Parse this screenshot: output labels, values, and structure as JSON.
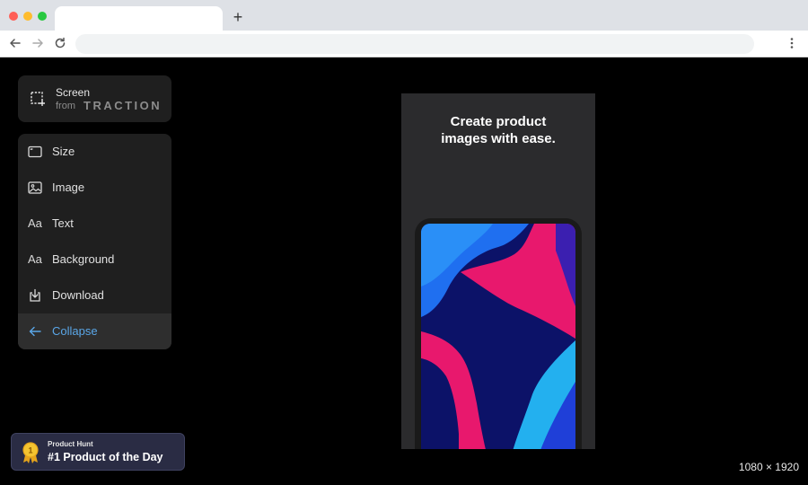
{
  "browser": {
    "new_tab_label": "+",
    "nav_back_icon": "arrow-left-icon",
    "nav_forward_icon": "arrow-right-icon",
    "reload_icon": "reload-icon",
    "menu_icon": "kebab-menu-icon"
  },
  "brand": {
    "title": "Screen",
    "from": "from",
    "company": "TRACTION",
    "icon": "screen-select-icon"
  },
  "menu": {
    "items": [
      {
        "label": "Size",
        "icon": "size-frame-icon"
      },
      {
        "label": "Image",
        "icon": "image-icon"
      },
      {
        "label": "Text",
        "icon": "text-aa-icon"
      },
      {
        "label": "Background",
        "icon": "text-aa-icon"
      },
      {
        "label": "Download",
        "icon": "download-icon"
      },
      {
        "label": "Collapse",
        "icon": "arrow-left-icon"
      }
    ]
  },
  "preview": {
    "headline_line1": "Create product",
    "headline_line2": "images with ease."
  },
  "product_hunt": {
    "small": "Product Hunt",
    "big": "#1 Product of the Day",
    "medal_number": "1"
  },
  "canvas": {
    "dimensions": "1080 × 1920"
  },
  "colors": {
    "accent": "#5aa7e8",
    "panel": "#1f1f1f",
    "badge": "#2a2c44",
    "wallpaper_pink": "#e8186d",
    "wallpaper_blue": "#1f6ff0",
    "wallpaper_navy": "#0c1268"
  }
}
